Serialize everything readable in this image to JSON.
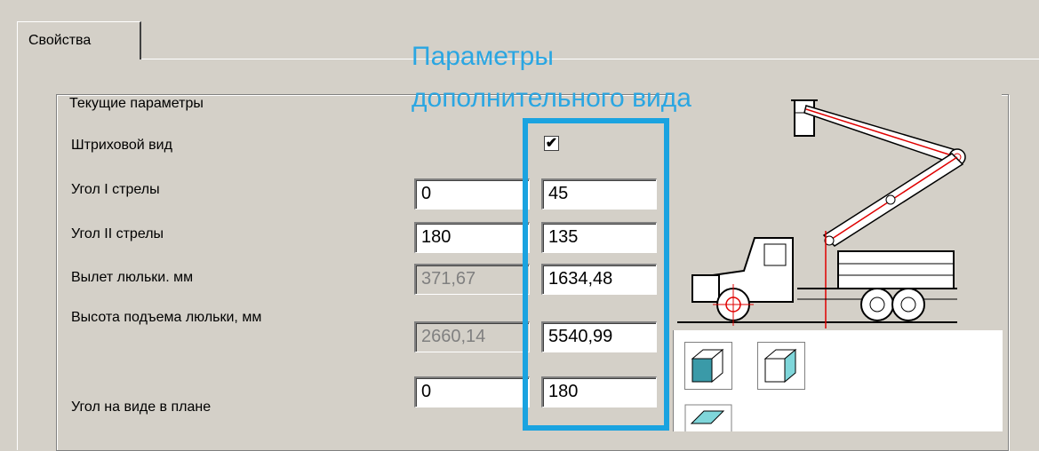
{
  "tab": {
    "label": "Свойства"
  },
  "annotation": {
    "line1": "Параметры",
    "line2": "дополнительного вида"
  },
  "group": {
    "title": "Текущие параметры"
  },
  "rows": [
    {
      "label": "Штриховой вид",
      "checked": "✔"
    },
    {
      "label": "Угол I стрелы",
      "current": "0",
      "extra": "45"
    },
    {
      "label": "Угол II стрелы",
      "current": "180",
      "extra": "135"
    },
    {
      "label": "Вылет люльки. мм",
      "current": "371,67",
      "extra": "1634,48"
    },
    {
      "label": "Высота подъема люльки, мм",
      "current": "2660,14",
      "extra": "5540,99"
    },
    {
      "label": "Угол на виде в плане",
      "current": "0",
      "extra": "180"
    }
  ],
  "preview": {
    "image": "aerial-lift-truck-diagram",
    "buttons": [
      "cube-shaded-front-icon",
      "cube-shaded-side-icon",
      "cube-shaded-top-icon"
    ]
  },
  "colors": {
    "highlight": "#1aa3e0",
    "annotation": "#2aa6e2",
    "window": "#d4d0c8"
  }
}
